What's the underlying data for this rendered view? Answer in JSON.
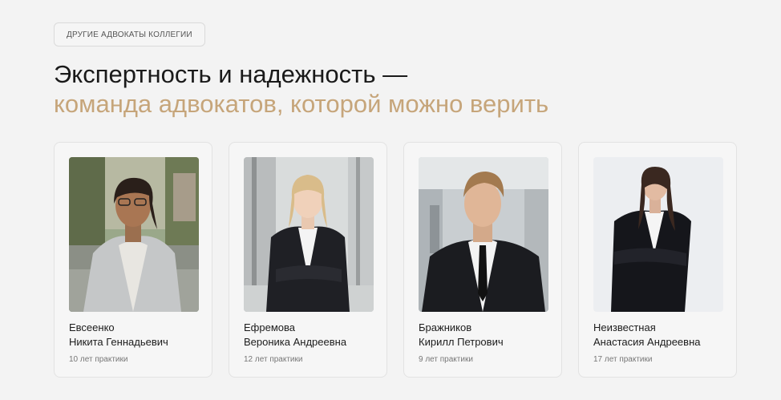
{
  "section_badge": "ДРУГИЕ АДВОКАТЫ КОЛЛЕГИИ",
  "heading": {
    "line1": "Экспертность и надежность —",
    "line2": "команда адвокатов, которой можно верить"
  },
  "colors": {
    "accent": "#c6a57a",
    "text": "#1a1a1a",
    "background": "#f3f3f3"
  },
  "lawyers": [
    {
      "surname": "Евсеенко",
      "given_names": "Никита Геннадьевич",
      "experience": "10 лет практики"
    },
    {
      "surname": "Ефремова",
      "given_names": "Вероника Андреевна",
      "experience": "12 лет практики"
    },
    {
      "surname": "Бражников",
      "given_names": "Кирилл Петрович",
      "experience": "9 лет практики"
    },
    {
      "surname": "Неизвестная",
      "given_names": "Анастасия Андреевна",
      "experience": "17 лет практики"
    }
  ]
}
